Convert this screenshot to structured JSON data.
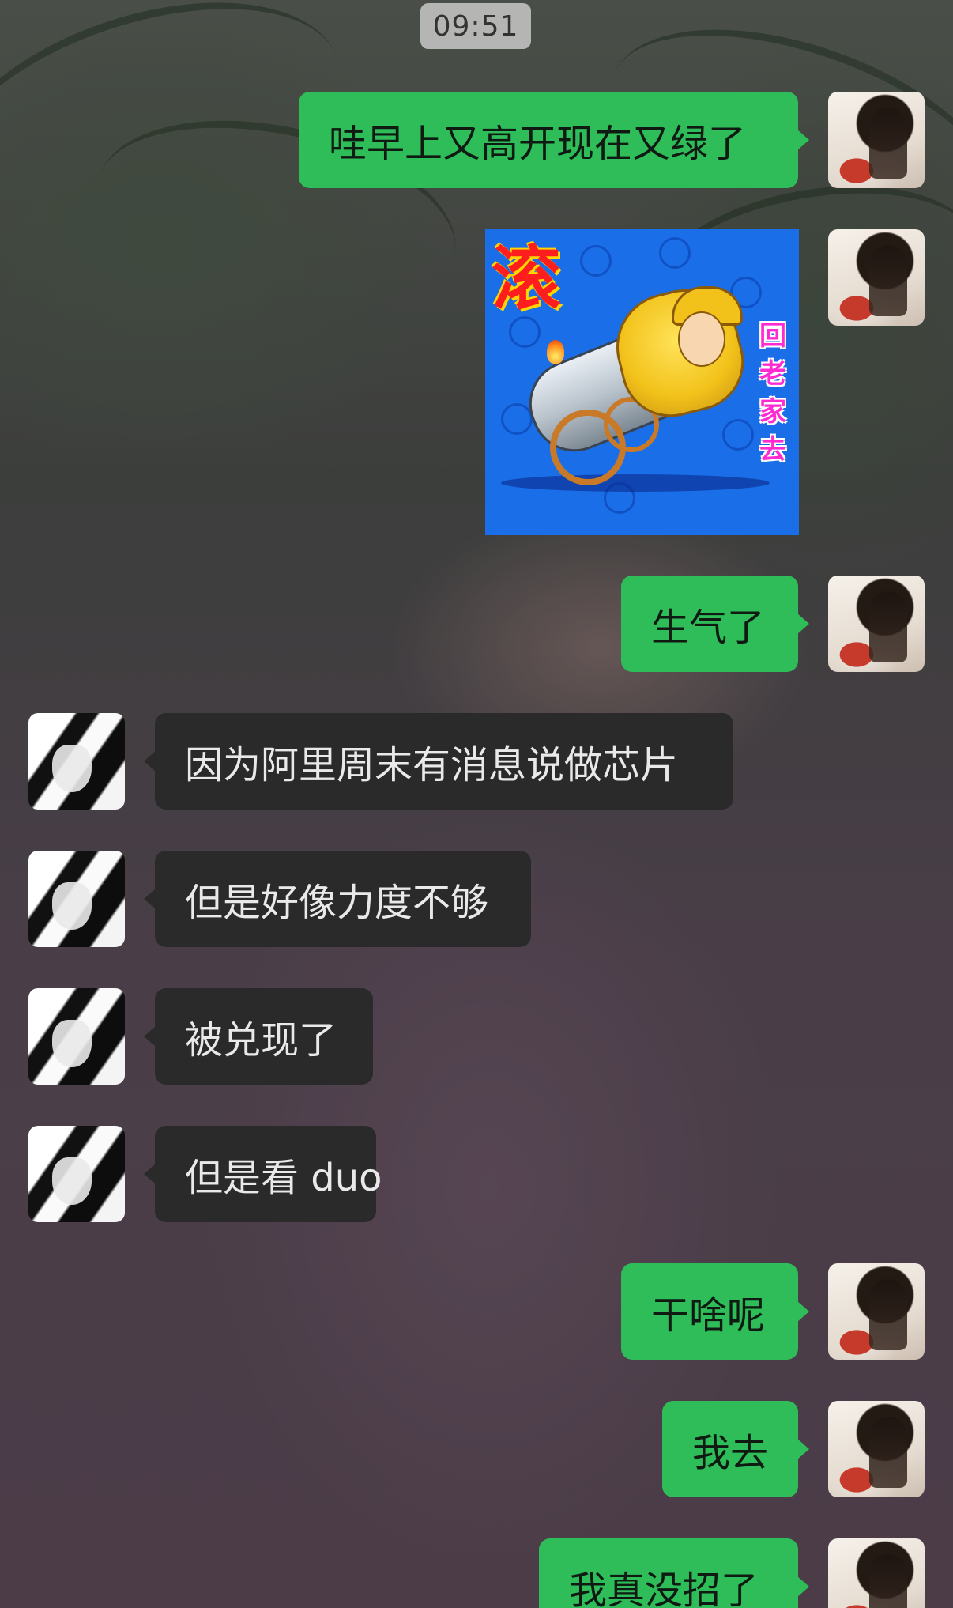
{
  "status": {
    "time": "09:51"
  },
  "messages": [
    {
      "from": "me",
      "type": "text",
      "text": "哇早上又高开现在又绿了"
    },
    {
      "from": "me",
      "type": "sticker",
      "sticker": {
        "big_char": "滚",
        "side_chars": [
          "回",
          "老",
          "家",
          "去"
        ]
      }
    },
    {
      "from": "me",
      "type": "text",
      "text": "生气了"
    },
    {
      "from": "other",
      "type": "text",
      "text": "因为阿里周末有消息说做芯片"
    },
    {
      "from": "other",
      "type": "text",
      "text": "但是好像力度不够"
    },
    {
      "from": "other",
      "type": "text",
      "text": "被兑现了"
    },
    {
      "from": "other",
      "type": "text",
      "text": "但是看 duo"
    },
    {
      "from": "me",
      "type": "text",
      "text": "干啥呢"
    },
    {
      "from": "me",
      "type": "text",
      "text": "我去"
    },
    {
      "from": "me",
      "type": "text",
      "text": "我真没招了"
    }
  ],
  "colors": {
    "my_bubble": "#2fbd5a",
    "other_bubble": "#2a2a2a",
    "other_text": "#e9e9e9",
    "my_text": "#0f1a12"
  }
}
